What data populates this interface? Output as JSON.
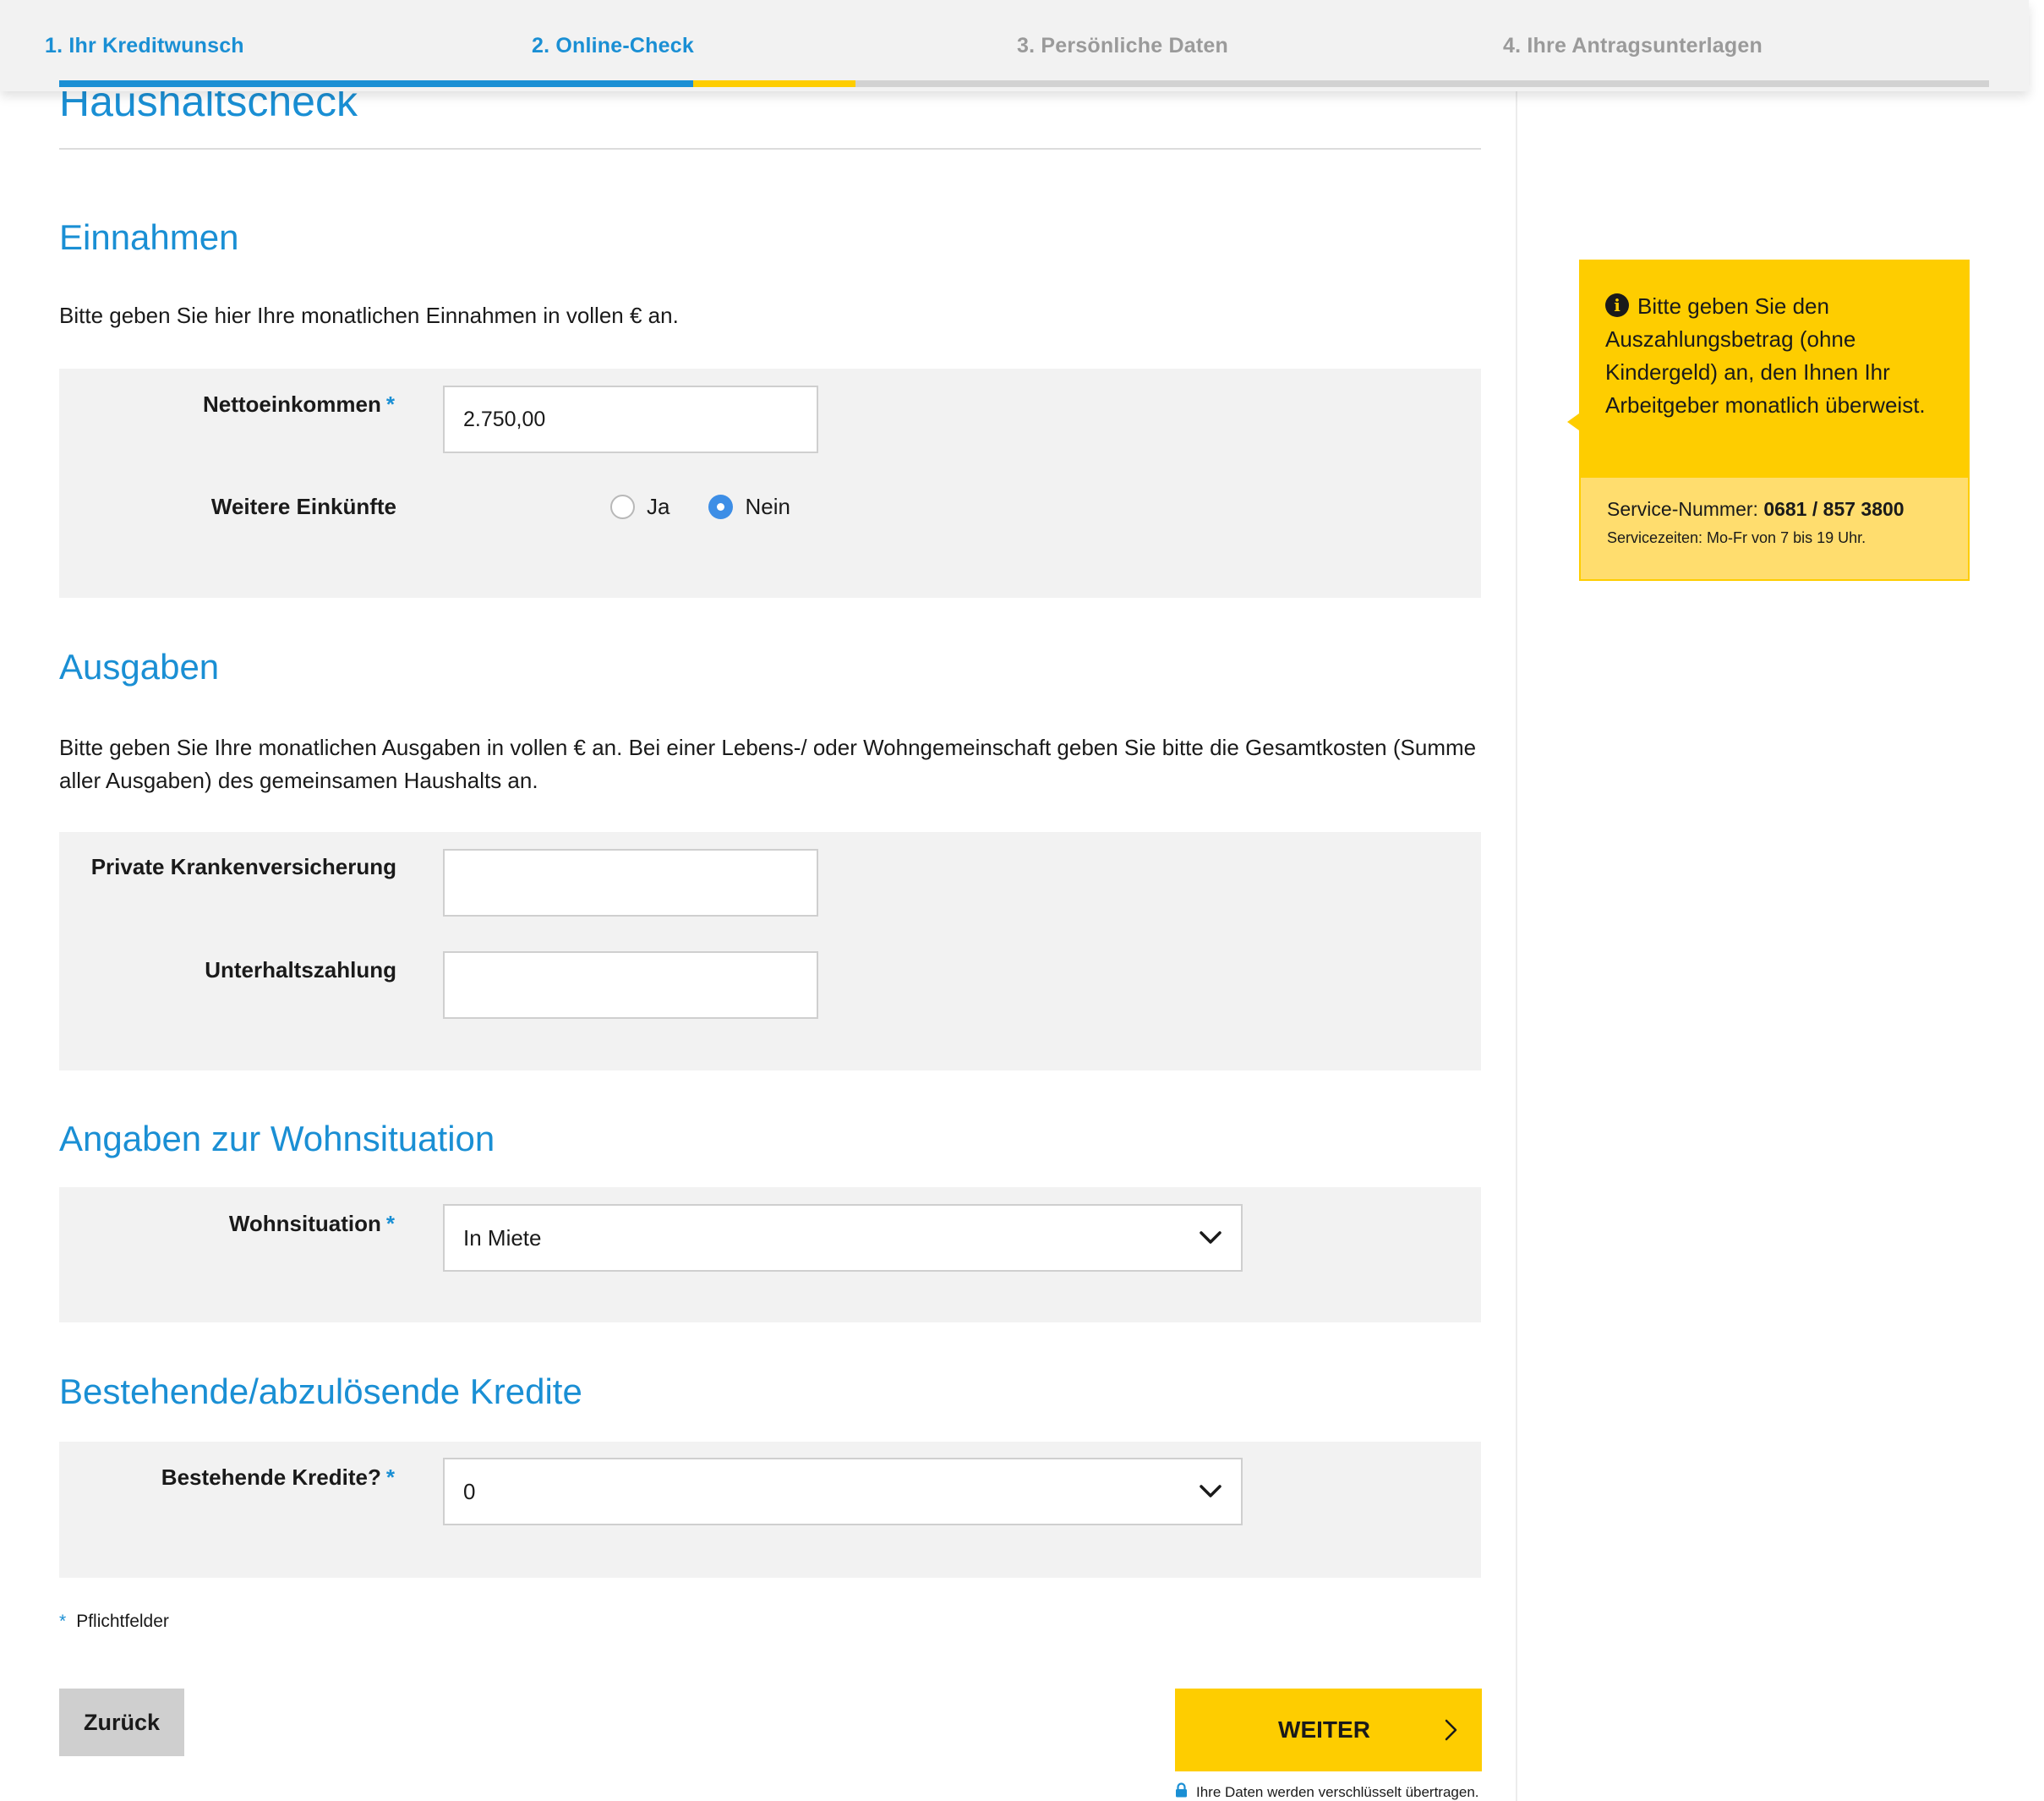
{
  "stepper": {
    "steps": [
      {
        "label": "1. Ihr Kreditwunsch",
        "state": "done"
      },
      {
        "label": "2. Online-Check",
        "state": "current"
      },
      {
        "label": "3. Persönliche Daten",
        "state": "todo"
      },
      {
        "label": "4. Ihre Antragsunterlagen",
        "state": "todo"
      }
    ]
  },
  "page": {
    "title": "Haushaltscheck"
  },
  "einnahmen": {
    "title": "Einnahmen",
    "description": "Bitte geben Sie hier Ihre monatlichen Einnahmen in vollen € an.",
    "netto_label": "Nettoeinkommen",
    "netto_value": "2.750,00",
    "weitere_label": "Weitere Einkünfte",
    "radio_ja": "Ja",
    "radio_nein": "Nein",
    "selected": "Nein"
  },
  "ausgaben": {
    "title": "Ausgaben",
    "description": "Bitte geben Sie Ihre monatlichen Ausgaben in vollen € an. Bei einer Lebens-/ oder Wohngemeinschaft geben Sie bitte die Gesamtkosten (Summe aller Ausgaben) des gemeinsamen Haushalts an.",
    "pkv_label": "Private Krankenversicherung",
    "pkv_value": "",
    "unterhalt_label": "Unterhaltszahlung",
    "unterhalt_value": ""
  },
  "wohnsituation": {
    "title": "Angaben zur Wohnsituation",
    "label": "Wohnsituation",
    "value": "In Miete"
  },
  "kredite": {
    "title": "Bestehende/abzulösende Kredite",
    "label": "Bestehende Kredite?",
    "value": "0"
  },
  "required_marker": "*",
  "required_note": "Pflichtfelder",
  "buttons": {
    "back": "Zurück",
    "next": "WEITER"
  },
  "secure_note": "Ihre Daten werden verschlüsselt übertragen.",
  "info": {
    "text": "Bitte geben Sie den Auszahlungsbetrag (ohne Kindergeld) an, den Ihnen Ihr Arbeitgeber monatlich überweist.",
    "service_prefix": "Service-Nummer:",
    "service_number": "0681 / 857 3800",
    "service_hours": "Servicezeiten: Mo-Fr von 7 bis 19 Uhr."
  },
  "colors": {
    "accent_blue": "#1a8fd4",
    "brand_yellow": "#fecd00",
    "radio_blue": "#3d8ee6",
    "panel_gray": "#f2f2f2"
  },
  "icons": {
    "info": "info-circle-icon",
    "chevron": "chevron-down-icon",
    "arrow": "chevron-right-icon",
    "lock": "lock-icon"
  }
}
